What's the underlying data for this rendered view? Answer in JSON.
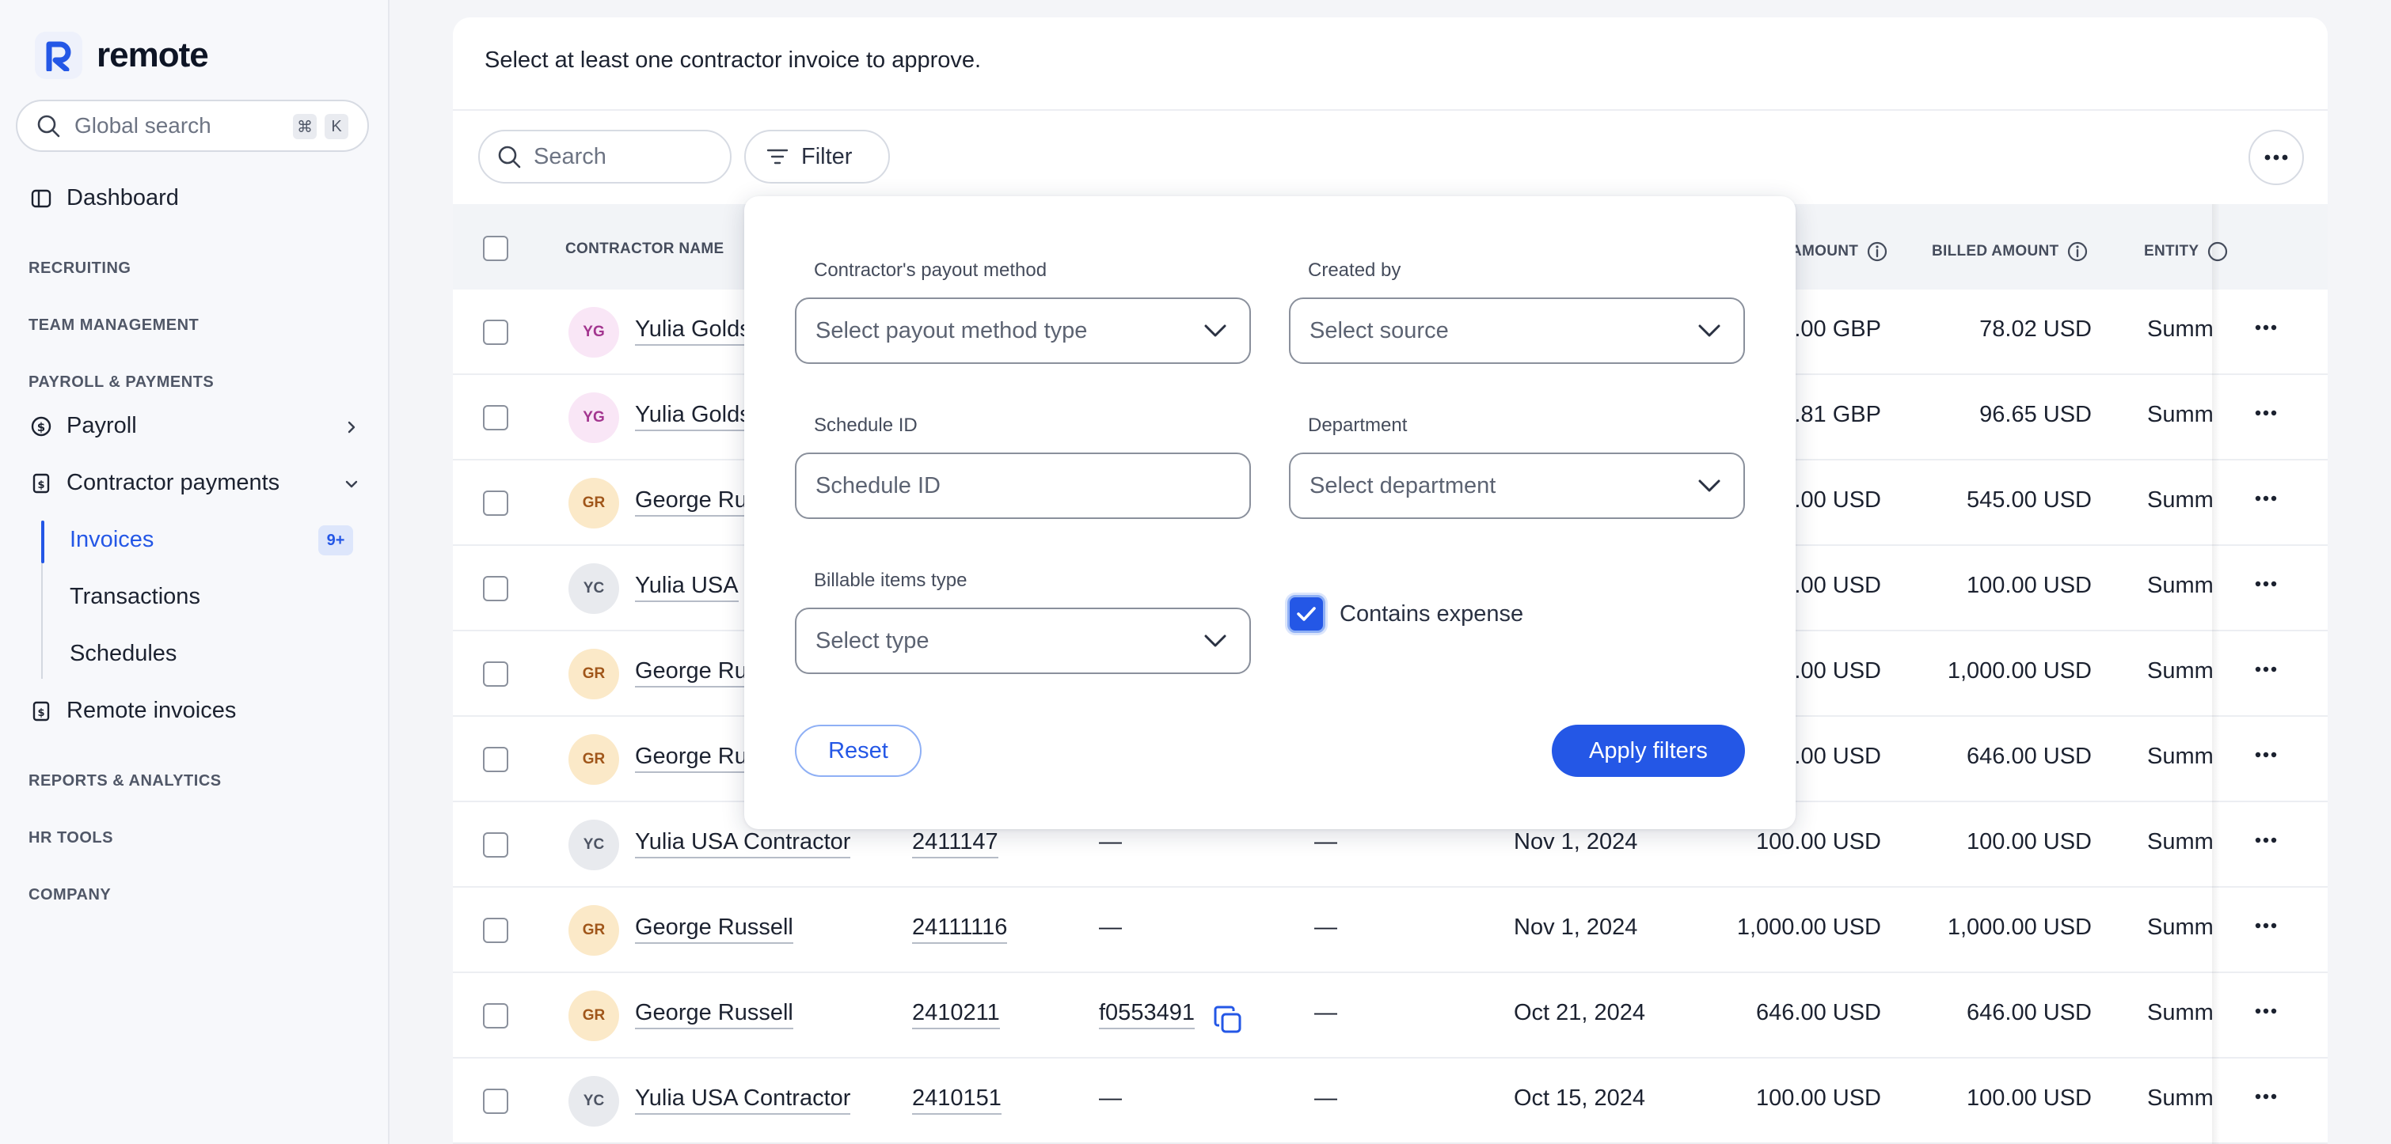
{
  "brand": {
    "name": "remote"
  },
  "global_search": {
    "placeholder": "Global search",
    "shortcut_keys": [
      "⌘",
      "K"
    ]
  },
  "sidebar": {
    "dashboard": "Dashboard",
    "sections": {
      "recruiting": "RECRUITING",
      "team_management": "TEAM MANAGEMENT",
      "payroll_payments": "PAYROLL & PAYMENTS",
      "reports_analytics": "REPORTS & ANALYTICS",
      "hr_tools": "HR TOOLS",
      "company": "COMPANY"
    },
    "payroll": "Payroll",
    "contractor_payments": "Contractor payments",
    "sub_items": [
      "Invoices",
      "Transactions",
      "Schedules"
    ],
    "invoices_badge": "9+",
    "remote_invoices": "Remote invoices"
  },
  "main": {
    "notice": "Select at least one contractor invoice to approve.",
    "search_placeholder": "Search",
    "filter_label": "Filter"
  },
  "table": {
    "headers": {
      "contractor_name": "CONTRACTOR NAME",
      "amount": "AMOUNT",
      "billed_amount": "BILLED AMOUNT",
      "entity": "ENTITY"
    },
    "rows": [
      {
        "initials": "YG",
        "name": "Yulia Golds",
        "schedule": "",
        "ref": "",
        "dept": "",
        "date": "",
        "amount": ".00 GBP",
        "billed": "78.02 USD",
        "entity": "Summ"
      },
      {
        "initials": "YG",
        "name": "Yulia Golds",
        "schedule": "",
        "ref": "",
        "dept": "",
        "date": "",
        "amount": ".81 GBP",
        "billed": "96.65 USD",
        "entity": "Summ"
      },
      {
        "initials": "GR",
        "name": "George Ru",
        "schedule": "",
        "ref": "",
        "dept": "",
        "date": "",
        "amount": ".00 USD",
        "billed": "545.00 USD",
        "entity": "Summ"
      },
      {
        "initials": "YC",
        "name": "Yulia USA",
        "schedule": "",
        "ref": "",
        "dept": "",
        "date": "",
        "amount": ".00 USD",
        "billed": "100.00 USD",
        "entity": "Summ"
      },
      {
        "initials": "GR",
        "name": "George Ru",
        "schedule": "",
        "ref": "",
        "dept": "",
        "date": "",
        "amount": ".00 USD",
        "billed": "1,000.00 USD",
        "entity": "Summ"
      },
      {
        "initials": "GR",
        "name": "George Ru",
        "schedule": "",
        "ref": "",
        "dept": "",
        "date": "",
        "amount": ".00 USD",
        "billed": "646.00 USD",
        "entity": "Summ"
      },
      {
        "initials": "YC",
        "name": "Yulia USA Contractor",
        "schedule": "2411147",
        "ref": "—",
        "dept": "—",
        "date": "Nov 1, 2024",
        "amount": "100.00 USD",
        "billed": "100.00 USD",
        "entity": "Summ"
      },
      {
        "initials": "GR",
        "name": "George Russell",
        "schedule": "24111116",
        "ref": "—",
        "dept": "—",
        "date": "Nov 1, 2024",
        "amount": "1,000.00 USD",
        "billed": "1,000.00 USD",
        "entity": "Summ"
      },
      {
        "initials": "GR",
        "name": "George Russell",
        "schedule": "2410211",
        "ref": "f0553491",
        "dept": "—",
        "date": "Oct 21, 2024",
        "amount": "646.00 USD",
        "billed": "646.00 USD",
        "entity": "Summ"
      },
      {
        "initials": "YC",
        "name": "Yulia USA Contractor",
        "schedule": "2410151",
        "ref": "—",
        "dept": "—",
        "date": "Oct 15, 2024",
        "amount": "100.00 USD",
        "billed": "100.00 USD",
        "entity": "Summ"
      }
    ]
  },
  "filters": {
    "payout_method": {
      "label": "Contractor's payout method",
      "placeholder": "Select payout method type"
    },
    "created_by": {
      "label": "Created by",
      "placeholder": "Select source"
    },
    "schedule_id": {
      "label": "Schedule ID",
      "placeholder": "Schedule ID"
    },
    "department": {
      "label": "Department",
      "placeholder": "Select department"
    },
    "billable_type": {
      "label": "Billable items type",
      "placeholder": "Select type"
    },
    "contains_expense": {
      "label": "Contains expense",
      "checked": true
    },
    "reset": "Reset",
    "apply": "Apply filters"
  },
  "colors": {
    "primary": "#2457e6",
    "text": "#1c2230",
    "muted": "#5c6372"
  }
}
